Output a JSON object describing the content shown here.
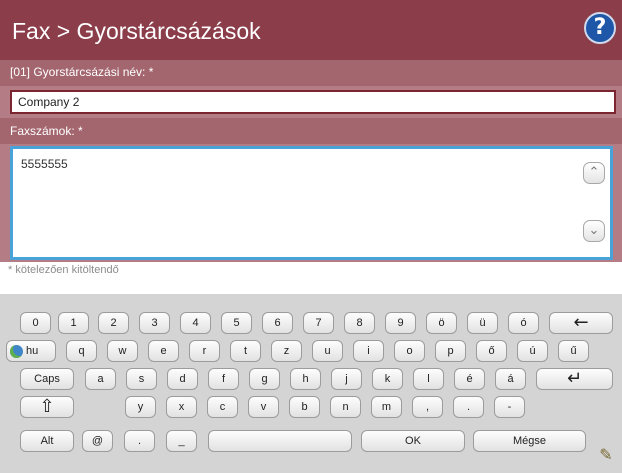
{
  "header": {
    "title": "Fax > Gyorstárcsázások",
    "help_icon": "?"
  },
  "form": {
    "name_label": "[01] Gyorstárcsázási név: *",
    "name_value": "Company 2",
    "numbers_label": "Faxszámok: *",
    "numbers_value": "5555555",
    "required_note": "* kötelezően kitöltendő",
    "scroll_up_icon": "chevron-up-icon",
    "scroll_down_icon": "chevron-down-icon"
  },
  "keyboard": {
    "row1": [
      "0",
      "1",
      "2",
      "3",
      "4",
      "5",
      "6",
      "7",
      "8",
      "9",
      "ö",
      "ü",
      "ó"
    ],
    "backspace": "←",
    "lang": "hu",
    "row2": [
      "q",
      "w",
      "e",
      "r",
      "t",
      "z",
      "u",
      "i",
      "o",
      "p",
      "ő",
      "ú",
      "ű"
    ],
    "caps": "Caps",
    "row3": [
      "a",
      "s",
      "d",
      "f",
      "g",
      "h",
      "j",
      "k",
      "l",
      "é",
      "á"
    ],
    "enter": "↵",
    "shift": "⇧",
    "row4": [
      "y",
      "x",
      "c",
      "v",
      "b",
      "n",
      "m",
      ",",
      ".",
      "-"
    ],
    "alt": "Alt",
    "at": "@",
    "dot": ".",
    "underscore": "_",
    "space": "",
    "ok": "OK",
    "cancel": "Mégse",
    "edit_icon": "pencil-icon",
    "colors": {
      "header": "#8b3d4a",
      "focus": "#4aa3d8"
    }
  }
}
